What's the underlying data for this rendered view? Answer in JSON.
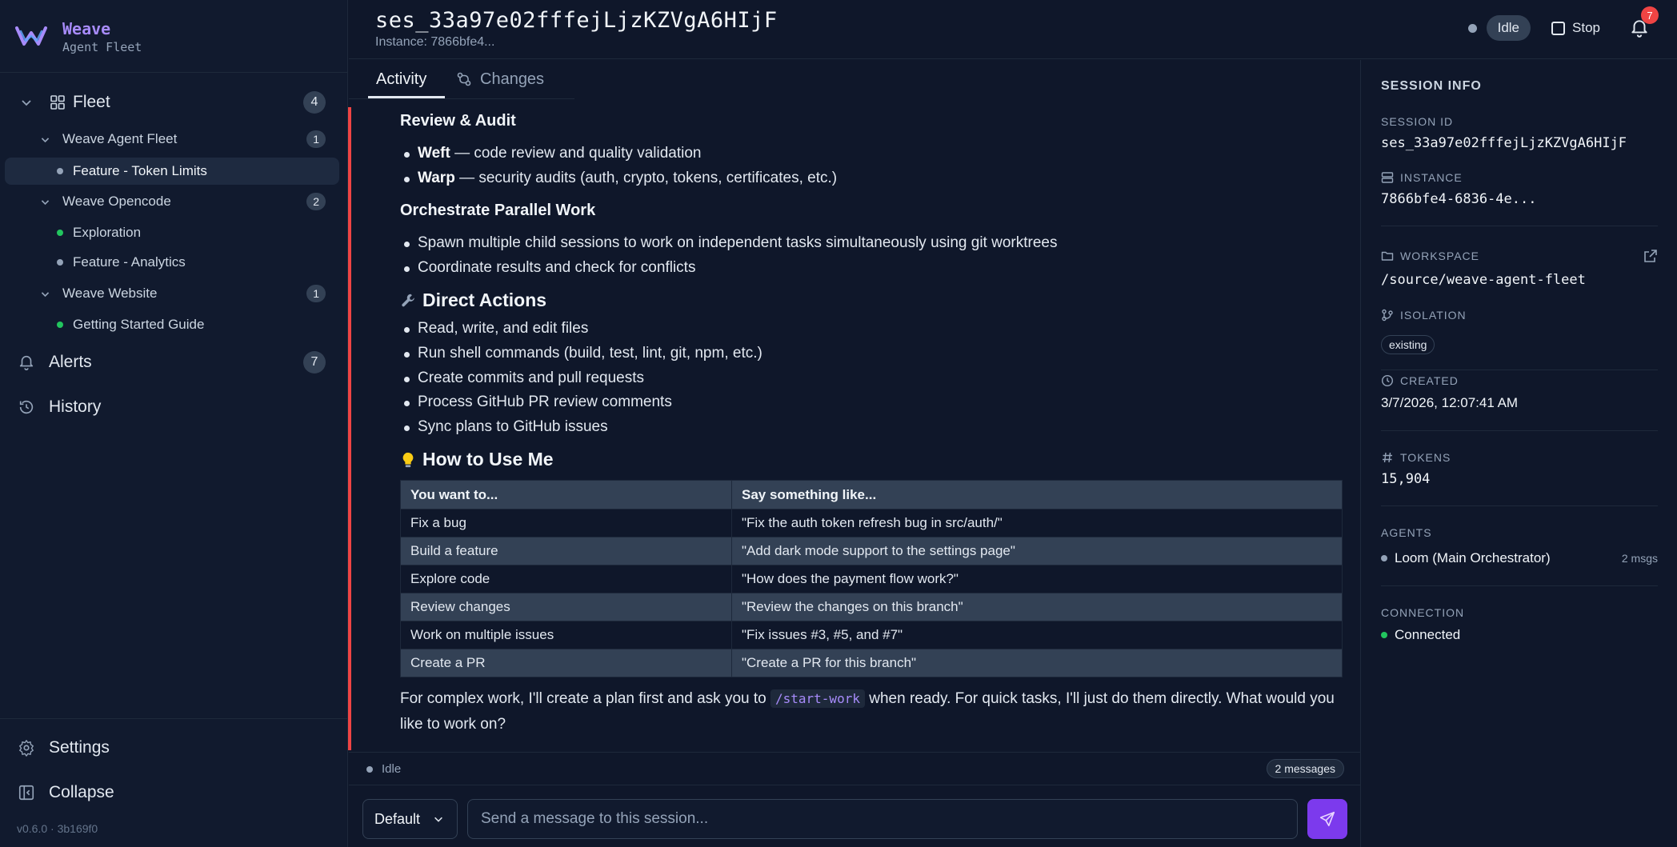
{
  "brand": {
    "name": "Weave",
    "subtitle": "Agent Fleet"
  },
  "sidebar": {
    "fleet": {
      "label": "Fleet",
      "count": "4"
    },
    "groups": [
      {
        "label": "Weave Agent Fleet",
        "count": "1",
        "items": [
          {
            "label": "Feature - Token Limits",
            "status": "gray",
            "active": true
          }
        ]
      },
      {
        "label": "Weave Opencode",
        "count": "2",
        "items": [
          {
            "label": "Exploration",
            "status": "green"
          },
          {
            "label": "Feature - Analytics",
            "status": "gray"
          }
        ]
      },
      {
        "label": "Weave Website",
        "count": "1",
        "items": [
          {
            "label": "Getting Started Guide",
            "status": "green"
          }
        ]
      }
    ],
    "alerts": {
      "label": "Alerts",
      "count": "7"
    },
    "history": {
      "label": "History"
    },
    "settings": {
      "label": "Settings"
    },
    "collapse": {
      "label": "Collapse"
    },
    "version": "v0.6.0 · 3b169f0"
  },
  "header": {
    "title": "ses_33a97e02fffejLjzKZVgA6HIjF",
    "instance": "Instance: 7866bfe4...",
    "status": "Idle",
    "stop_label": "Stop",
    "notification_count": "7"
  },
  "tabs": {
    "activity": "Activity",
    "changes": "Changes"
  },
  "content": {
    "review_heading": "Review & Audit",
    "review_items": [
      {
        "bold": "Weft",
        "text": " — code review and quality validation"
      },
      {
        "bold": "Warp",
        "text": " — security audits (auth, crypto, tokens, certificates, etc.)"
      }
    ],
    "parallel_heading": "Orchestrate Parallel Work",
    "parallel_items": [
      "Spawn multiple child sessions to work on independent tasks simultaneously using git worktrees",
      "Coordinate results and check for conflicts"
    ],
    "actions_heading": "Direct Actions",
    "actions_items": [
      "Read, write, and edit files",
      "Run shell commands (build, test, lint, git, npm, etc.)",
      "Create commits and pull requests",
      "Process GitHub PR review comments",
      "Sync plans to GitHub issues"
    ],
    "howto_heading": "How to Use Me",
    "table": {
      "headers": [
        "You want to...",
        "Say something like..."
      ],
      "rows": [
        [
          "Fix a bug",
          "\"Fix the auth token refresh bug in src/auth/\""
        ],
        [
          "Build a feature",
          "\"Add dark mode support to the settings page\""
        ],
        [
          "Explore code",
          "\"How does the payment flow work?\""
        ],
        [
          "Review changes",
          "\"Review the changes on this branch\""
        ],
        [
          "Work on multiple issues",
          "\"Fix issues #3, #5, and #7\""
        ],
        [
          "Create a PR",
          "\"Create a PR for this branch\""
        ]
      ]
    },
    "closing_before": "For complex work, I'll create a plan first and ask you to ",
    "closing_code": "/start-work",
    "closing_after": " when ready. For quick tasks, I'll just do them directly. What would you like to work on?"
  },
  "status_bar": {
    "status": "Idle",
    "messages": "2 messages"
  },
  "composer": {
    "model": "Default",
    "placeholder": "Send a message to this session..."
  },
  "session_info": {
    "heading": "SESSION INFO",
    "session_id_label": "SESSION ID",
    "session_id": "ses_33a97e02fffejLjzKZVgA6HIjF",
    "instance_label": "INSTANCE",
    "instance": "7866bfe4-6836-4e...",
    "workspace_label": "WORKSPACE",
    "workspace": "/source/weave-agent-fleet",
    "isolation_label": "ISOLATION",
    "isolation": "existing",
    "created_label": "CREATED",
    "created": "3/7/2026, 12:07:41 AM",
    "tokens_label": "TOKENS",
    "tokens": "15,904",
    "agents_label": "AGENTS",
    "agent_name": "Loom (Main Orchestrator)",
    "agent_msgs": "2 msgs",
    "connection_label": "CONNECTION",
    "connection": "Connected"
  },
  "colors": {
    "accent": "#7c3aed",
    "brand": "#a78bfa",
    "danger": "#ef4444",
    "success": "#22c55e"
  }
}
